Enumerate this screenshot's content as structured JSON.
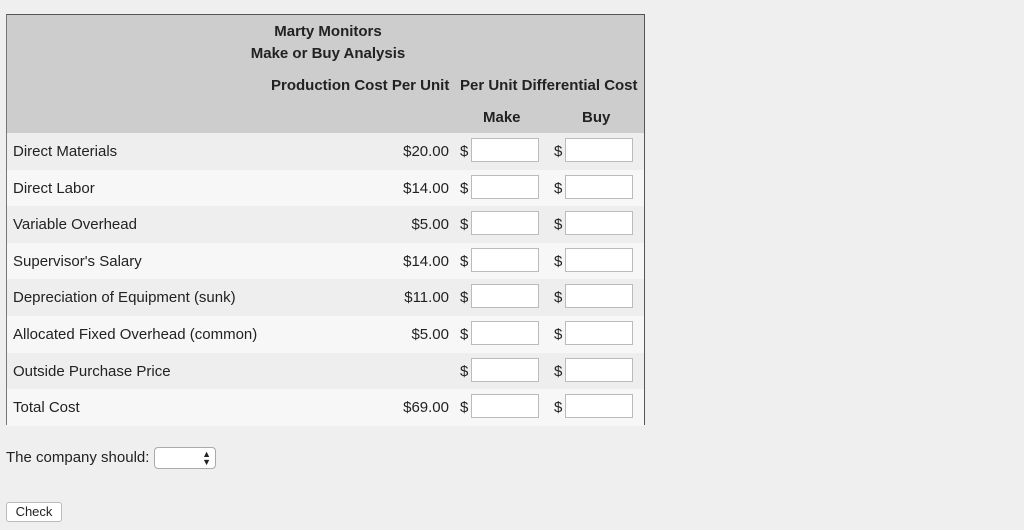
{
  "header": {
    "company": "Marty Monitors",
    "title": "Make or Buy Analysis",
    "col_production": "Production Cost Per Unit",
    "col_differential": "Per Unit Differential Cost",
    "col_make": "Make",
    "col_buy": "Buy"
  },
  "rows": [
    {
      "label": "Direct Materials",
      "cost": "$20.00"
    },
    {
      "label": "Direct Labor",
      "cost": "$14.00"
    },
    {
      "label": "Variable Overhead",
      "cost": "$5.00"
    },
    {
      "label": "Supervisor's Salary",
      "cost": "$14.00"
    },
    {
      "label": "Depreciation of Equipment (sunk)",
      "cost": "$11.00"
    },
    {
      "label": "Allocated Fixed Overhead (common)",
      "cost": "$5.00"
    },
    {
      "label": "Outside Purchase Price",
      "cost": ""
    },
    {
      "label": "Total Cost",
      "cost": "$69.00"
    }
  ],
  "currency_symbol": "$",
  "decision": {
    "label": "The company should:",
    "selected": ""
  },
  "check_label": "Check"
}
